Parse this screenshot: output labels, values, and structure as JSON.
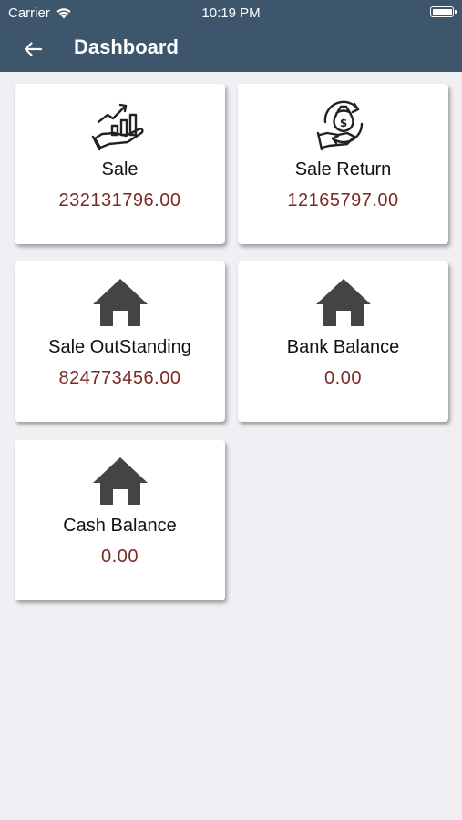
{
  "status_bar": {
    "carrier": "Carrier",
    "time": "10:19 PM"
  },
  "header": {
    "title": "Dashboard",
    "background": "#3e566c"
  },
  "cards": [
    {
      "label": "Sale",
      "value": "232131796.00",
      "icon": "sales-growth-icon"
    },
    {
      "label": "Sale Return",
      "value": "12165797.00",
      "icon": "money-return-icon"
    },
    {
      "label": "Sale OutStanding",
      "value": "824773456.00",
      "icon": "home-icon"
    },
    {
      "label": "Bank Balance",
      "value": "0.00",
      "icon": "home-icon"
    },
    {
      "label": "Cash Balance",
      "value": "0.00",
      "icon": "home-icon"
    }
  ],
  "colors": {
    "value_text": "#7a2a25",
    "page_background": "#efeff4"
  }
}
